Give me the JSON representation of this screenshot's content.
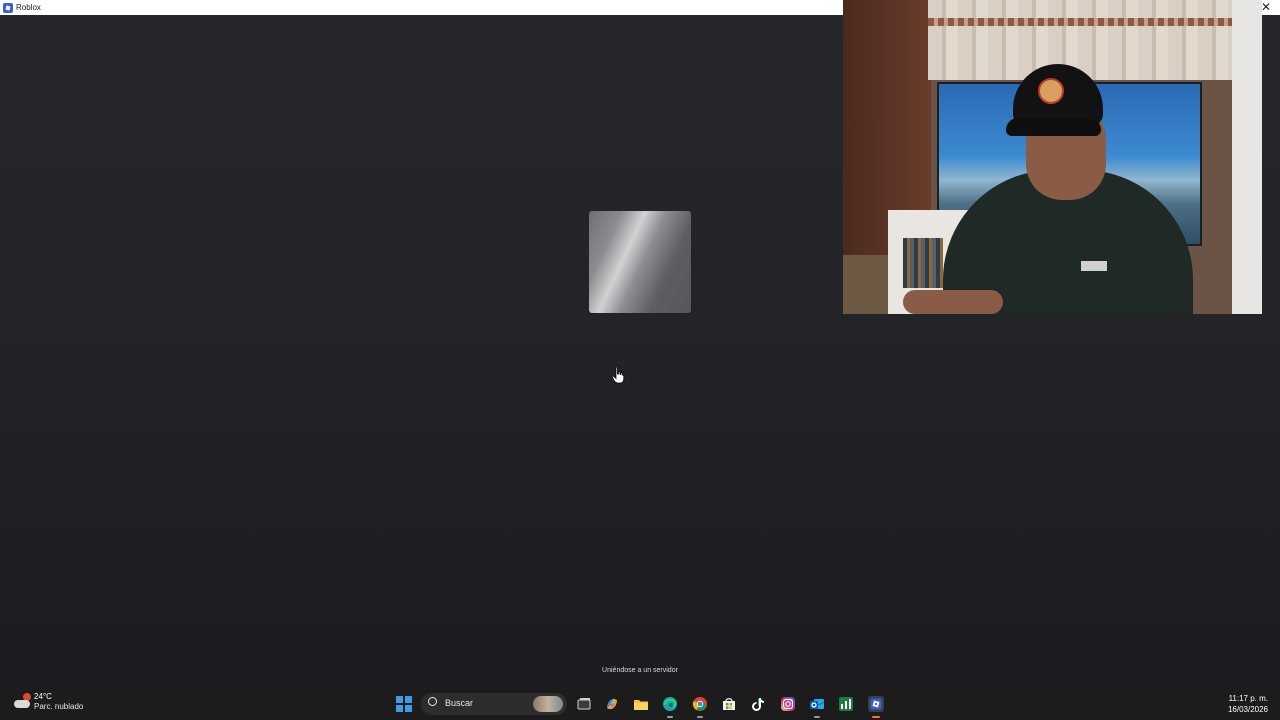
{
  "window": {
    "title": "Roblox",
    "close_glyph": "✕",
    "status_text": "Uniéndose a un servidor"
  },
  "taskbar": {
    "weather": {
      "temperature": "24°C",
      "description": "Parc. nublado",
      "icon": "partly-cloudy-icon"
    },
    "search": {
      "label": "Buscar"
    },
    "apps": [
      {
        "name": "task-view",
        "icon": "task-view-icon"
      },
      {
        "name": "copilot",
        "icon": "copilot-icon"
      },
      {
        "name": "file-explorer",
        "icon": "folder-icon"
      },
      {
        "name": "edge",
        "icon": "edge-icon"
      },
      {
        "name": "chrome",
        "icon": "chrome-icon"
      },
      {
        "name": "store",
        "icon": "store-icon"
      },
      {
        "name": "tiktok",
        "icon": "tiktok-icon"
      },
      {
        "name": "instagram",
        "icon": "instagram-icon"
      },
      {
        "name": "outlook",
        "icon": "outlook-icon"
      },
      {
        "name": "excel",
        "icon": "excel-icon"
      },
      {
        "name": "roblox",
        "icon": "roblox-icon",
        "active": true
      }
    ],
    "clock": {
      "time": "11:17 p. m.",
      "date": "16/03/2026"
    }
  },
  "colors": {
    "background": "#222428",
    "taskbar": "#1c1c1c",
    "windows_blue": "#3d9be9",
    "roblox_blue": "#3a5fd6"
  }
}
